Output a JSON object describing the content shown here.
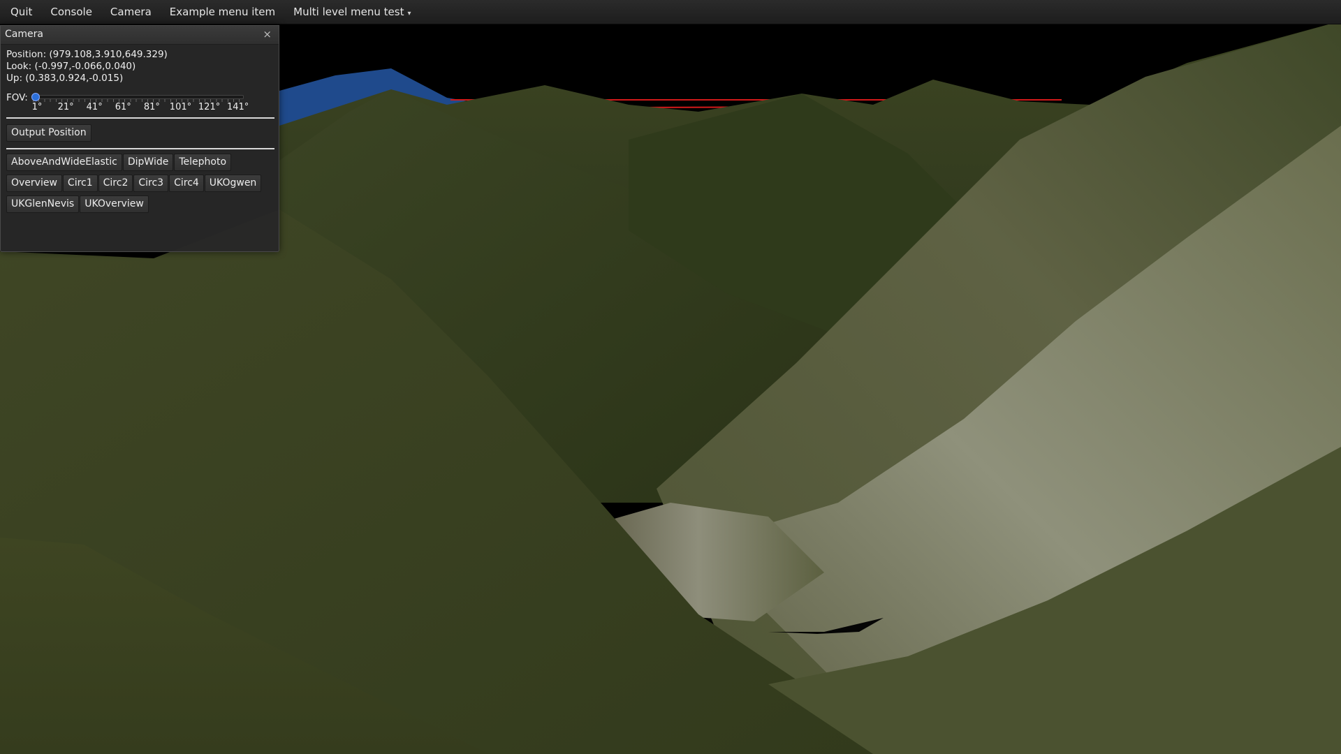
{
  "menu": {
    "items": [
      "Quit",
      "Console",
      "Camera",
      "Example menu item",
      "Multi level menu test"
    ],
    "dropdown_caret": "▾"
  },
  "camera_window": {
    "title": "Camera",
    "close_glyph": "×",
    "position_text": "Position: (979.108,3.910,649.329)",
    "look_text": "Look: (-0.997,-0.066,0.040)",
    "up_text": "Up: (0.383,0.924,-0.015)",
    "fov": {
      "label": "FOV:",
      "tick_labels": [
        "1°",
        "21°",
        "41°",
        "61°",
        "81°",
        "101°",
        "121°",
        "141°"
      ],
      "min": 1,
      "max": 141,
      "value": 1
    },
    "output_position_label": "Output Position",
    "preset_rows": [
      [
        "AboveAndWideElastic",
        "DipWide",
        "Telephoto"
      ],
      [
        "Overview",
        "Circ1",
        "Circ2",
        "Circ3",
        "Circ4",
        "UKOgwen"
      ],
      [
        "UKGlenNevis",
        "UKOverview"
      ]
    ]
  },
  "colors": {
    "sky": "#000000",
    "terrain_dark": "#2a3318",
    "terrain_light": "#8e9278",
    "water": "#1f4a8c",
    "horizon_line": "#d21a1a",
    "fov_handle": "#2b6fd8"
  }
}
